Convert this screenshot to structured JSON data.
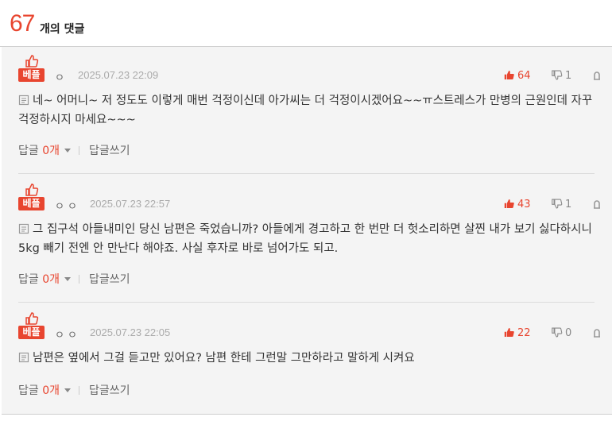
{
  "header": {
    "count": "67",
    "label": "개의 댓글"
  },
  "colors": {
    "accent": "#e8452f",
    "muted": "#aaaaaa",
    "bg": "#f4f4f4"
  },
  "comments": [
    {
      "badge": "베플",
      "nickname": "ㅇ",
      "date": "2025.07.23 22:09",
      "up": "64",
      "down": "1",
      "text": "네~ 어머니~ 저 정도도 이렇게 매번 걱정이신데 아가씨는 더 걱정이시겠어요~~ㅠ스트레스가 만병의 근원인데 자꾸 걱정하시지 마세요~~~",
      "reply_label": "답글",
      "reply_count": "0개",
      "write_label": "답글쓰기"
    },
    {
      "badge": "베플",
      "nickname": "ㅇㅇ",
      "date": "2025.07.23 22:57",
      "up": "43",
      "down": "1",
      "text": "그 집구석 아들내미인 당신 남편은 죽었습니까? 아들에게 경고하고 한 번만 더 헛소리하면 살찐 내가 보기 싫다하시니 5kg 빼기 전엔 안 만난다 해야죠. 사실 후자로 바로 넘어가도 되고.",
      "reply_label": "답글",
      "reply_count": "0개",
      "write_label": "답글쓰기"
    },
    {
      "badge": "베플",
      "nickname": "ㅇㅇ",
      "date": "2025.07.23 22:05",
      "up": "22",
      "down": "0",
      "text": "남편은 옆에서 그걸 듣고만 있어요? 남편 한테 그런말 그만하라고 말하게 시켜요",
      "reply_label": "답글",
      "reply_count": "0개",
      "write_label": "답글쓰기"
    }
  ]
}
